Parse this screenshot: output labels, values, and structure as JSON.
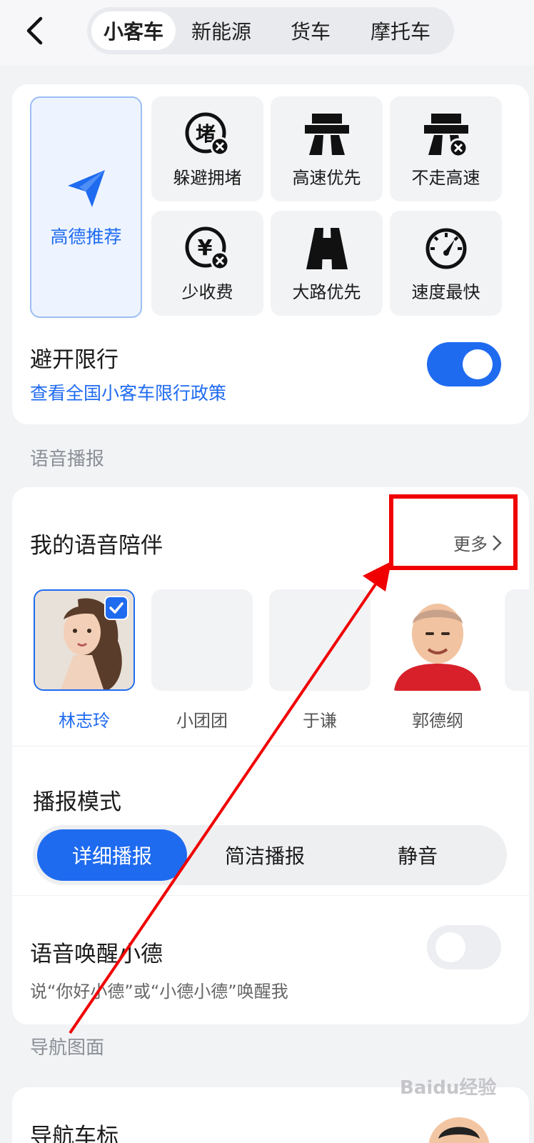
{
  "header": {
    "back_icon": "chevron-left-icon",
    "tabs": [
      {
        "label": "小客车",
        "active": true
      },
      {
        "label": "新能源",
        "active": false
      },
      {
        "label": "货车",
        "active": false
      },
      {
        "label": "摩托车",
        "active": false
      }
    ]
  },
  "route_prefs": {
    "recommend": {
      "label": "高德推荐",
      "icon": "paper-plane-icon"
    },
    "options": [
      {
        "label": "躲避拥堵",
        "icon": "avoid-congestion-icon"
      },
      {
        "label": "高速优先",
        "icon": "highway-icon"
      },
      {
        "label": "不走高速",
        "icon": "no-highway-icon"
      },
      {
        "label": "少收费",
        "icon": "less-toll-icon"
      },
      {
        "label": "大路优先",
        "icon": "main-road-icon"
      },
      {
        "label": "速度最快",
        "icon": "speedometer-icon"
      }
    ],
    "restriction": {
      "title": "避开限行",
      "link": "查看全国小客车限行政策",
      "enabled": true
    }
  },
  "voice_section": {
    "label": "语音播报",
    "companion_title": "我的语音陪伴",
    "more_label": "更多",
    "voices": [
      {
        "name": "林志玲",
        "selected": true
      },
      {
        "name": "小团团",
        "selected": false
      },
      {
        "name": "于谦",
        "selected": false
      },
      {
        "name": "郭德纲",
        "selected": false
      }
    ],
    "mode_title": "播报模式",
    "modes": [
      {
        "label": "详细播报",
        "active": true
      },
      {
        "label": "简洁播报",
        "active": false
      },
      {
        "label": "静音",
        "active": false
      }
    ],
    "wake": {
      "title": "语音唤醒小德",
      "desc": "说“你好小德”或“小德小德”唤醒我",
      "enabled": false
    }
  },
  "nav_section": {
    "label": "导航图面",
    "car_icon_title": "导航车标"
  },
  "watermark": "Baidu经验",
  "colors": {
    "accent": "#1f6bf0",
    "annotation": "#f00000",
    "background": "#f2f3f5"
  }
}
